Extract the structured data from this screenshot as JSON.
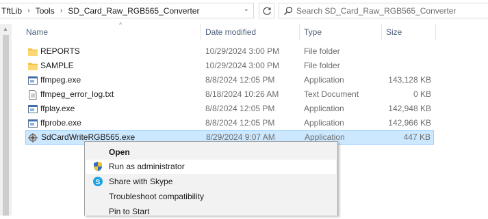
{
  "breadcrumb": [
    "TftLib",
    "Tools",
    "SD_Card_Raw_RGB565_Converter"
  ],
  "search": {
    "placeholder": "Search SD_Card_Raw_RGB565_Converter"
  },
  "columns": {
    "name": "Name",
    "date": "Date modified",
    "type": "Type",
    "size": "Size"
  },
  "files": [
    {
      "name": "REPORTS",
      "date": "10/29/2024 3:00 PM",
      "type": "File folder",
      "size": "",
      "icon": "folder-icon"
    },
    {
      "name": "SAMPLE",
      "date": "10/29/2024 3:00 PM",
      "type": "File folder",
      "size": "",
      "icon": "folder-icon"
    },
    {
      "name": "ffmpeg.exe",
      "date": "8/8/2024 12:05 PM",
      "type": "Application",
      "size": "143,128 KB",
      "icon": "application-icon"
    },
    {
      "name": "ffmpeg_error_log.txt",
      "date": "8/18/2024 10:26 AM",
      "type": "Text Document",
      "size": "0 KB",
      "icon": "text-file-icon"
    },
    {
      "name": "ffplay.exe",
      "date": "8/8/2024 12:05 PM",
      "type": "Application",
      "size": "142,948 KB",
      "icon": "application-icon"
    },
    {
      "name": "ffprobe.exe",
      "date": "8/8/2024 12:05 PM",
      "type": "Application",
      "size": "142,966 KB",
      "icon": "application-icon"
    },
    {
      "name": "SdCardWriteRGB565.exe",
      "date": "8/29/2024 9:07 AM",
      "type": "Application",
      "size": "447 KB",
      "icon": "program-icon",
      "selected": true
    }
  ],
  "context_menu": [
    {
      "label": "Open",
      "bold": true,
      "icon": ""
    },
    {
      "label": "Run as administrator",
      "icon": "uac-shield-icon",
      "hover": true
    },
    {
      "label": "Share with Skype",
      "icon": "skype-icon"
    },
    {
      "label": "Troubleshoot compatibility",
      "icon": ""
    },
    {
      "label": "Pin to Start",
      "icon": ""
    }
  ],
  "colors": {
    "selection_bg": "#cce8ff",
    "selection_border": "#99d1ff",
    "header_text": "#4c607a",
    "folder": "#f5c342"
  }
}
